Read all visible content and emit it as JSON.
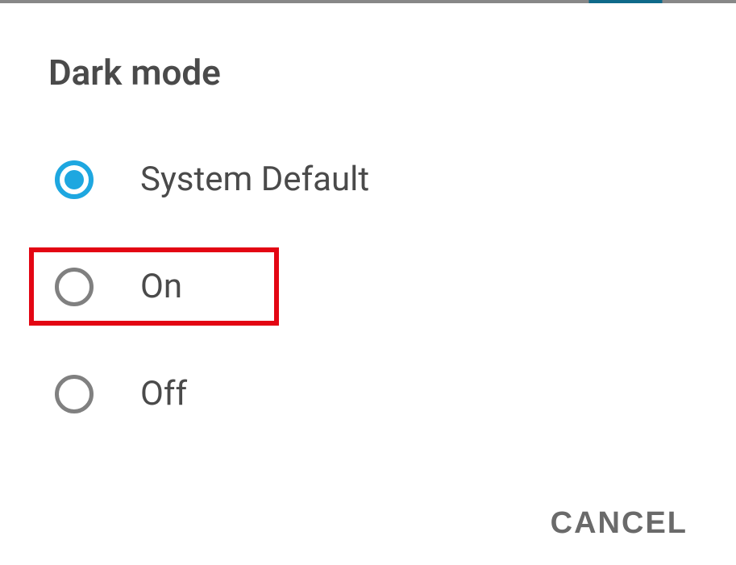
{
  "dialog": {
    "title": "Dark mode",
    "options": [
      {
        "label": "System Default",
        "selected": true
      },
      {
        "label": "On",
        "selected": false,
        "highlighted": true
      },
      {
        "label": "Off",
        "selected": false
      }
    ],
    "cancel_label": "CANCEL"
  },
  "colors": {
    "accent": "#1ea7e0",
    "text": "#4a4a4a",
    "highlight_border": "#e30613"
  }
}
